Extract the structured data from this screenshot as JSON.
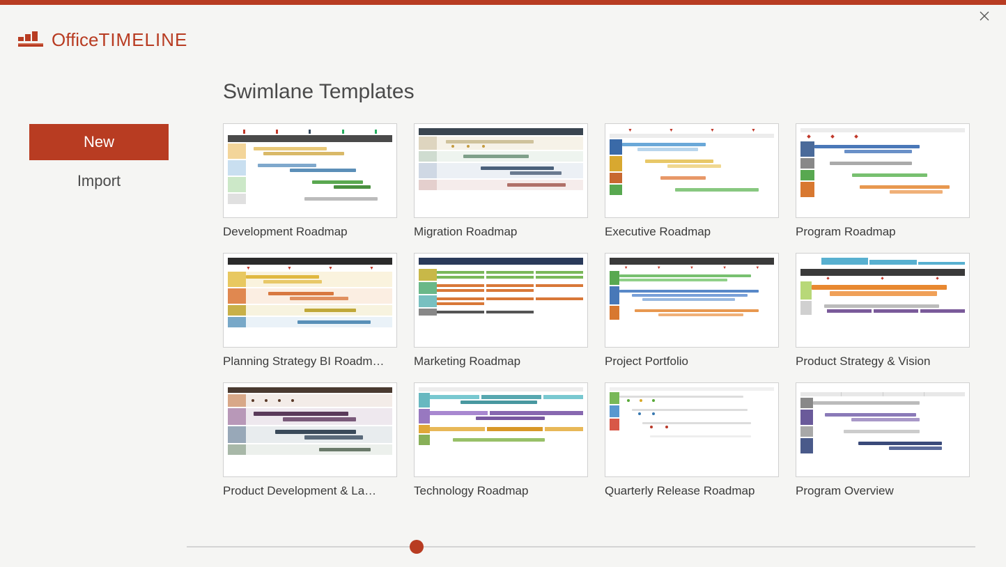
{
  "brand": {
    "name_light": "Office",
    "name_bold": "TIMELINE"
  },
  "sidebar": {
    "items": [
      {
        "label": "New",
        "active": true
      },
      {
        "label": "Import",
        "active": false
      }
    ]
  },
  "page": {
    "title": "Swimlane Templates"
  },
  "templates": [
    {
      "label": "Development Roadmap"
    },
    {
      "label": "Migration Roadmap"
    },
    {
      "label": "Executive Roadmap"
    },
    {
      "label": "Program Roadmap"
    },
    {
      "label": "Planning Strategy BI Roadm…"
    },
    {
      "label": "Marketing Roadmap"
    },
    {
      "label": "Project Portfolio"
    },
    {
      "label": "Product Strategy & Vision"
    },
    {
      "label": "Product Development & La…"
    },
    {
      "label": "Technology Roadmap"
    },
    {
      "label": "Quarterly Release Roadmap"
    },
    {
      "label": "Program Overview"
    }
  ],
  "colors": {
    "brand": "#b83c22"
  }
}
